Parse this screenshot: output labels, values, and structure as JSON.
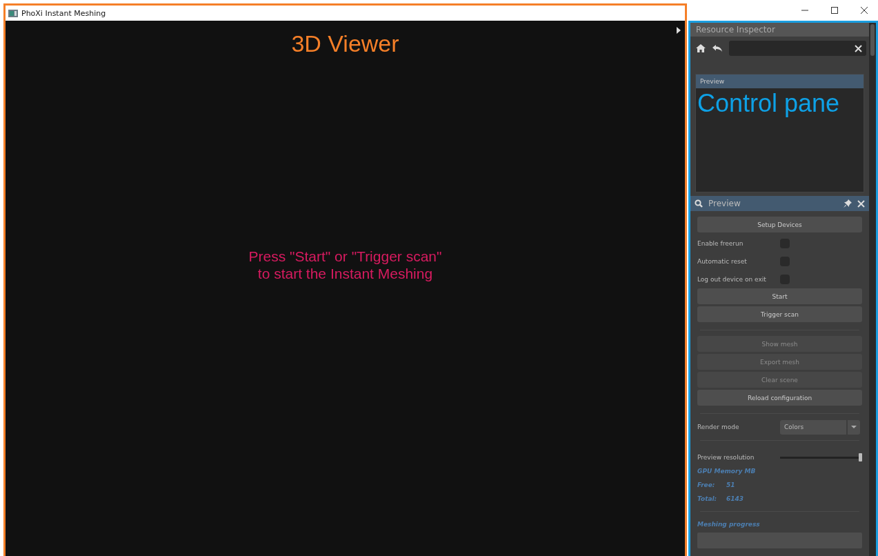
{
  "window": {
    "title": "PhoXi Instant Meshing"
  },
  "viewer": {
    "annotation": "3D Viewer",
    "message": "Press \"Start\" or \"Trigger scan\"\nto start the Instant Meshing"
  },
  "inspector": {
    "title": "Resource Inspector",
    "preview_header": "Preview",
    "annotation": "Control pane"
  },
  "panel": {
    "title": "Preview",
    "controls": [
      {
        "kind": "button",
        "label": "Setup Devices",
        "disabled": false
      },
      {
        "kind": "checkbox",
        "label": "Enable freerun",
        "checked": false
      },
      {
        "kind": "checkbox",
        "label": "Automatic reset",
        "checked": false
      },
      {
        "kind": "checkbox",
        "label": "Log out device on exit",
        "checked": false
      },
      {
        "kind": "button",
        "label": "Start",
        "disabled": false
      },
      {
        "kind": "button",
        "label": "Trigger scan",
        "disabled": false
      },
      {
        "kind": "divider"
      },
      {
        "kind": "button",
        "label": "Show mesh",
        "disabled": true
      },
      {
        "kind": "button",
        "label": "Export mesh",
        "disabled": true
      },
      {
        "kind": "button",
        "label": "Clear scene",
        "disabled": true
      },
      {
        "kind": "button",
        "label": "Reload configuration",
        "disabled": false
      },
      {
        "kind": "divider"
      },
      {
        "kind": "dropdown",
        "label": "Render mode",
        "value": "Colors"
      },
      {
        "kind": "divider"
      },
      {
        "kind": "slider",
        "label": "Preview resolution",
        "level": 1
      },
      {
        "kind": "info",
        "label": "GPU Memory MB"
      },
      {
        "kind": "stat",
        "label": "Free:",
        "value": "51"
      },
      {
        "kind": "stat",
        "label": "Total:",
        "value": "6143"
      },
      {
        "kind": "divider"
      },
      {
        "kind": "info",
        "label": "Meshing progress"
      },
      {
        "kind": "progress",
        "level": 0
      }
    ]
  }
}
